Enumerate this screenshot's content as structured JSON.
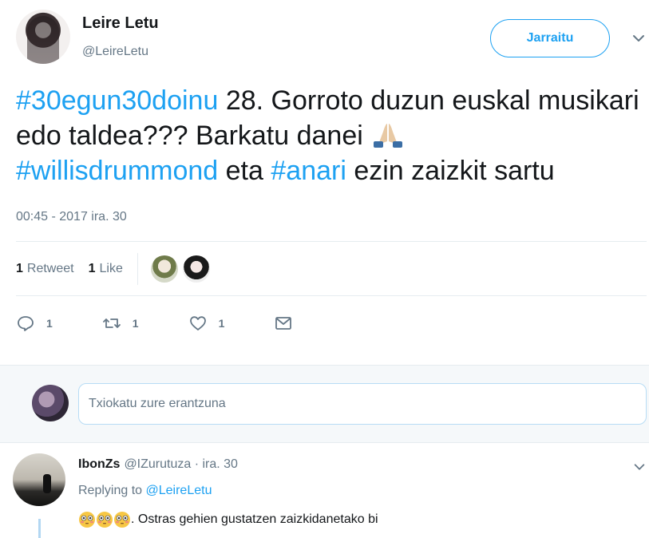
{
  "header": {
    "name": "Leire Letu",
    "handle": "@LeireLetu",
    "follow_label": "Jarraitu"
  },
  "tweet": {
    "hashtag1": "#30egun30doinu",
    "text1": " 28. Gorroto duzun euskal musikari edo taldea??? Barkatu danei ",
    "hashtag2": "#willisdrummond",
    "text2": " eta ",
    "hashtag3": "#anari",
    "text3": " ezin zaizkit sartu",
    "timestamp": "00:45 - 2017 ira. 30"
  },
  "stats": {
    "retweet_count": "1",
    "retweet_label": "Retweet",
    "like_count": "1",
    "like_label": "Like"
  },
  "actions": {
    "reply_count": "1",
    "retweet_count": "1",
    "like_count": "1"
  },
  "reply_box": {
    "placeholder": "Txiokatu zure erantzuna"
  },
  "reply": {
    "name": "IbonZs",
    "handle": "@IZurutuza",
    "date": " · ira. 30",
    "replying_prefix": "Replying to ",
    "replying_mention": "@LeireLetu",
    "text": ". Ostras gehien gustatzen zaizkidanetako bi"
  },
  "colors": {
    "accent": "#1da1f2",
    "muted": "#657786",
    "text": "#14171a"
  }
}
